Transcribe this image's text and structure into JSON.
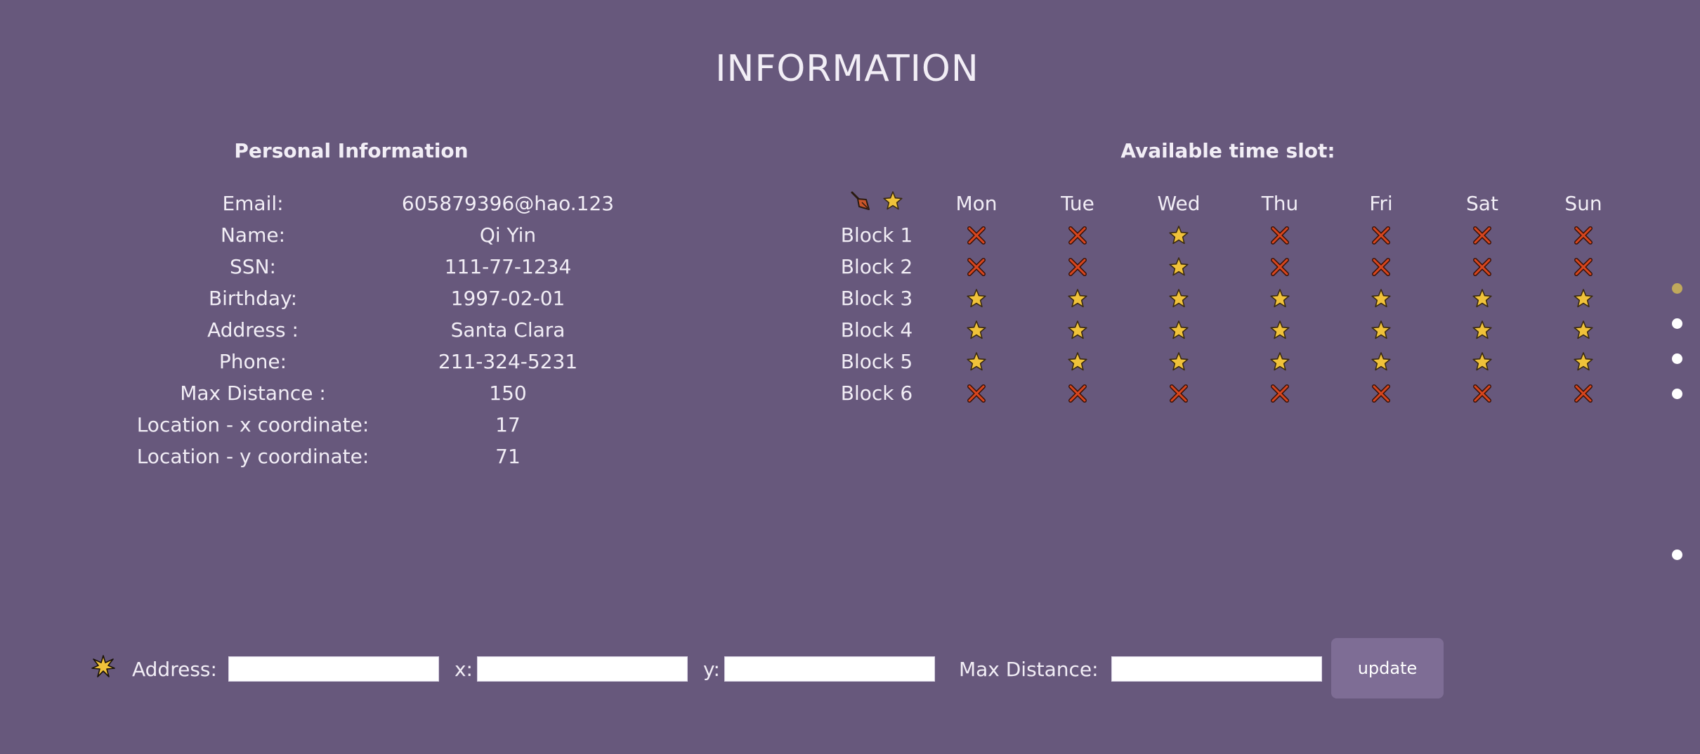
{
  "page": {
    "title": "INFORMATION"
  },
  "personal": {
    "title": "Personal Information",
    "fields": [
      {
        "label": "Email:",
        "value": "605879396@hao.123"
      },
      {
        "label": "Name:",
        "value": "Qi Yin"
      },
      {
        "label": "SSN:",
        "value": "111-77-1234"
      },
      {
        "label": "Birthday:",
        "value": "1997-02-01"
      },
      {
        "label": "Address :",
        "value": "Santa Clara"
      },
      {
        "label": "Phone:",
        "value": "211-324-5231"
      },
      {
        "label": "Max Distance :",
        "value": "150"
      },
      {
        "label": "Location - x coordinate:",
        "value": "17"
      },
      {
        "label": "Location - y coordinate:",
        "value": "71"
      }
    ]
  },
  "timeslot": {
    "title": "Available time slot:",
    "header_icons": [
      "brush-icon",
      "star-icon"
    ],
    "days": [
      "Mon",
      "Tue",
      "Wed",
      "Thu",
      "Fri",
      "Sat",
      "Sun"
    ],
    "blocks": [
      {
        "label": "Block 1",
        "slots": [
          "x",
          "x",
          "star",
          "x",
          "x",
          "x",
          "x"
        ]
      },
      {
        "label": "Block 2",
        "slots": [
          "x",
          "x",
          "star",
          "x",
          "x",
          "x",
          "x"
        ]
      },
      {
        "label": "Block 3",
        "slots": [
          "star",
          "star",
          "star",
          "star",
          "star",
          "star",
          "star"
        ]
      },
      {
        "label": "Block 4",
        "slots": [
          "star",
          "star",
          "star",
          "star",
          "star",
          "star",
          "star"
        ]
      },
      {
        "label": "Block 5",
        "slots": [
          "star",
          "star",
          "star",
          "star",
          "star",
          "star",
          "star"
        ]
      },
      {
        "label": "Block 6",
        "slots": [
          "x",
          "x",
          "x",
          "x",
          "x",
          "x",
          "x"
        ]
      }
    ]
  },
  "nav_dots": {
    "count": 5,
    "active_index": 0
  },
  "update_form": {
    "icon": "sparkle-star-icon",
    "address_label": "Address:",
    "address_value": "",
    "x_label": "x:",
    "x_value": "",
    "y_label": "y:",
    "y_value": "",
    "max_distance_label": "Max Distance:",
    "max_distance_value": "",
    "button_label": "update"
  },
  "colors": {
    "background": "#67587c",
    "text": "#f2eef6",
    "star": "#f0c23a",
    "cross": "#d8461e",
    "active_dot": "#c0a95c",
    "button": "#7e6d95"
  }
}
